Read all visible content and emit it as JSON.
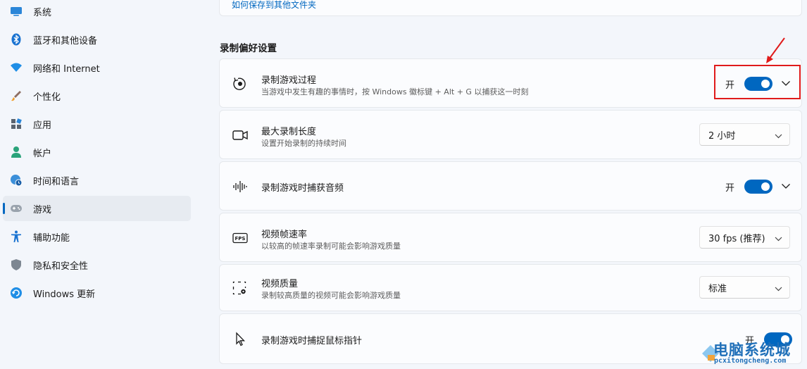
{
  "sidebar": {
    "items": [
      {
        "label": "系统",
        "icon": "display-icon"
      },
      {
        "label": "蓝牙和其他设备",
        "icon": "bluetooth-icon"
      },
      {
        "label": "网络和 Internet",
        "icon": "wifi-icon"
      },
      {
        "label": "个性化",
        "icon": "brush-icon"
      },
      {
        "label": "应用",
        "icon": "apps-icon"
      },
      {
        "label": "帐户",
        "icon": "person-icon"
      },
      {
        "label": "时间和语言",
        "icon": "globe-clock-icon"
      },
      {
        "label": "游戏",
        "icon": "gamepad-icon",
        "active": true
      },
      {
        "label": "辅助功能",
        "icon": "accessibility-icon"
      },
      {
        "label": "隐私和安全性",
        "icon": "shield-icon"
      },
      {
        "label": "Windows 更新",
        "icon": "update-icon"
      }
    ]
  },
  "main": {
    "top_link": "如何保存到其他文件夹",
    "section_title": "录制偏好设置",
    "settings": [
      {
        "title": "录制游戏过程",
        "desc": "当游戏中发生有趣的事情时，按 Windows 徽标键 + Alt + G 以捕获这一时刻",
        "toggle_label": "开",
        "toggle_on": true,
        "icon": "record-icon"
      },
      {
        "title": "最大录制长度",
        "desc": "设置开始录制的持续时间",
        "value": "2 小时",
        "icon": "video-camera-icon"
      },
      {
        "title": "录制游戏时捕获音频",
        "toggle_label": "开",
        "toggle_on": true,
        "icon": "audio-wave-icon"
      },
      {
        "title": "视频帧速率",
        "desc": "以较高的帧速率录制可能会影响游戏质量",
        "value": "30 fps (推荐)",
        "icon": "fps-icon"
      },
      {
        "title": "视频质量",
        "desc": "录制较高质量的视频可能会影响游戏质量",
        "value": "标准",
        "icon": "video-settings-icon"
      },
      {
        "title": "录制游戏时捕捉鼠标指针",
        "toggle_label": "开",
        "toggle_on": true,
        "icon": "cursor-icon"
      }
    ]
  },
  "watermark": {
    "title": "电脑系统城",
    "url": "pcxitongcheng.com"
  },
  "colors": {
    "accent": "#0067c0",
    "highlight": "#e01b1b",
    "background": "#f3f6fb"
  }
}
